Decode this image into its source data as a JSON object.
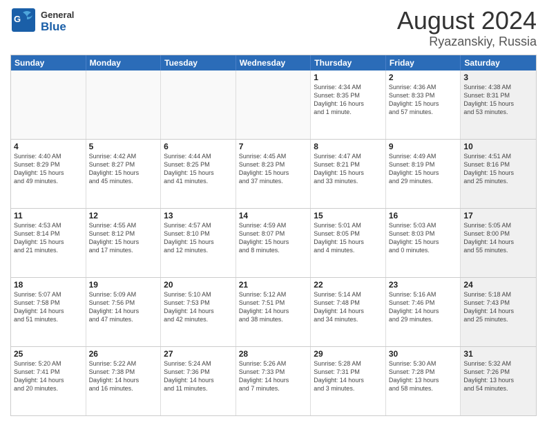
{
  "header": {
    "logo_general": "General",
    "logo_blue": "Blue",
    "month": "August 2024",
    "location": "Ryazanskiy, Russia"
  },
  "days_of_week": [
    "Sunday",
    "Monday",
    "Tuesday",
    "Wednesday",
    "Thursday",
    "Friday",
    "Saturday"
  ],
  "weeks": [
    [
      {
        "day": "",
        "info": "",
        "empty": true
      },
      {
        "day": "",
        "info": "",
        "empty": true
      },
      {
        "day": "",
        "info": "",
        "empty": true
      },
      {
        "day": "",
        "info": "",
        "empty": true
      },
      {
        "day": "1",
        "info": "Sunrise: 4:34 AM\nSunset: 8:35 PM\nDaylight: 16 hours\nand 1 minute."
      },
      {
        "day": "2",
        "info": "Sunrise: 4:36 AM\nSunset: 8:33 PM\nDaylight: 15 hours\nand 57 minutes."
      },
      {
        "day": "3",
        "info": "Sunrise: 4:38 AM\nSunset: 8:31 PM\nDaylight: 15 hours\nand 53 minutes."
      }
    ],
    [
      {
        "day": "4",
        "info": "Sunrise: 4:40 AM\nSunset: 8:29 PM\nDaylight: 15 hours\nand 49 minutes."
      },
      {
        "day": "5",
        "info": "Sunrise: 4:42 AM\nSunset: 8:27 PM\nDaylight: 15 hours\nand 45 minutes."
      },
      {
        "day": "6",
        "info": "Sunrise: 4:44 AM\nSunset: 8:25 PM\nDaylight: 15 hours\nand 41 minutes."
      },
      {
        "day": "7",
        "info": "Sunrise: 4:45 AM\nSunset: 8:23 PM\nDaylight: 15 hours\nand 37 minutes."
      },
      {
        "day": "8",
        "info": "Sunrise: 4:47 AM\nSunset: 8:21 PM\nDaylight: 15 hours\nand 33 minutes."
      },
      {
        "day": "9",
        "info": "Sunrise: 4:49 AM\nSunset: 8:19 PM\nDaylight: 15 hours\nand 29 minutes."
      },
      {
        "day": "10",
        "info": "Sunrise: 4:51 AM\nSunset: 8:16 PM\nDaylight: 15 hours\nand 25 minutes."
      }
    ],
    [
      {
        "day": "11",
        "info": "Sunrise: 4:53 AM\nSunset: 8:14 PM\nDaylight: 15 hours\nand 21 minutes."
      },
      {
        "day": "12",
        "info": "Sunrise: 4:55 AM\nSunset: 8:12 PM\nDaylight: 15 hours\nand 17 minutes."
      },
      {
        "day": "13",
        "info": "Sunrise: 4:57 AM\nSunset: 8:10 PM\nDaylight: 15 hours\nand 12 minutes."
      },
      {
        "day": "14",
        "info": "Sunrise: 4:59 AM\nSunset: 8:07 PM\nDaylight: 15 hours\nand 8 minutes."
      },
      {
        "day": "15",
        "info": "Sunrise: 5:01 AM\nSunset: 8:05 PM\nDaylight: 15 hours\nand 4 minutes."
      },
      {
        "day": "16",
        "info": "Sunrise: 5:03 AM\nSunset: 8:03 PM\nDaylight: 15 hours\nand 0 minutes."
      },
      {
        "day": "17",
        "info": "Sunrise: 5:05 AM\nSunset: 8:00 PM\nDaylight: 14 hours\nand 55 minutes."
      }
    ],
    [
      {
        "day": "18",
        "info": "Sunrise: 5:07 AM\nSunset: 7:58 PM\nDaylight: 14 hours\nand 51 minutes."
      },
      {
        "day": "19",
        "info": "Sunrise: 5:09 AM\nSunset: 7:56 PM\nDaylight: 14 hours\nand 47 minutes."
      },
      {
        "day": "20",
        "info": "Sunrise: 5:10 AM\nSunset: 7:53 PM\nDaylight: 14 hours\nand 42 minutes."
      },
      {
        "day": "21",
        "info": "Sunrise: 5:12 AM\nSunset: 7:51 PM\nDaylight: 14 hours\nand 38 minutes."
      },
      {
        "day": "22",
        "info": "Sunrise: 5:14 AM\nSunset: 7:48 PM\nDaylight: 14 hours\nand 34 minutes."
      },
      {
        "day": "23",
        "info": "Sunrise: 5:16 AM\nSunset: 7:46 PM\nDaylight: 14 hours\nand 29 minutes."
      },
      {
        "day": "24",
        "info": "Sunrise: 5:18 AM\nSunset: 7:43 PM\nDaylight: 14 hours\nand 25 minutes."
      }
    ],
    [
      {
        "day": "25",
        "info": "Sunrise: 5:20 AM\nSunset: 7:41 PM\nDaylight: 14 hours\nand 20 minutes."
      },
      {
        "day": "26",
        "info": "Sunrise: 5:22 AM\nSunset: 7:38 PM\nDaylight: 14 hours\nand 16 minutes."
      },
      {
        "day": "27",
        "info": "Sunrise: 5:24 AM\nSunset: 7:36 PM\nDaylight: 14 hours\nand 11 minutes."
      },
      {
        "day": "28",
        "info": "Sunrise: 5:26 AM\nSunset: 7:33 PM\nDaylight: 14 hours\nand 7 minutes."
      },
      {
        "day": "29",
        "info": "Sunrise: 5:28 AM\nSunset: 7:31 PM\nDaylight: 14 hours\nand 3 minutes."
      },
      {
        "day": "30",
        "info": "Sunrise: 5:30 AM\nSunset: 7:28 PM\nDaylight: 13 hours\nand 58 minutes."
      },
      {
        "day": "31",
        "info": "Sunrise: 5:32 AM\nSunset: 7:26 PM\nDaylight: 13 hours\nand 54 minutes."
      }
    ]
  ]
}
